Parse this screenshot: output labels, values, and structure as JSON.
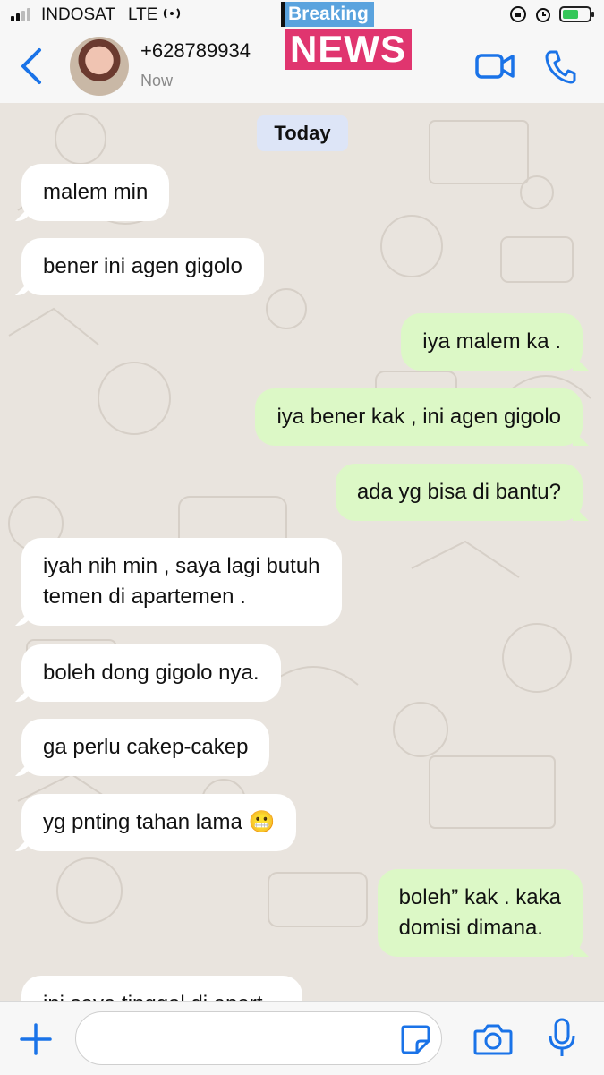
{
  "status_bar": {
    "carrier": "INDOSAT",
    "network": "LTE",
    "breaking_label": "Breaking",
    "news_label": "NEWS",
    "battery_level": 0.6
  },
  "header": {
    "contact_name": "+628789934",
    "contact_status": "Now"
  },
  "chat": {
    "day_label": "Today",
    "messages": [
      {
        "dir": "in",
        "text": "malem min"
      },
      {
        "dir": "in",
        "text": "bener ini agen gigolo"
      },
      {
        "dir": "out",
        "text": "iya malem ka ."
      },
      {
        "dir": "out",
        "text": "iya bener kak , ini agen gigolo"
      },
      {
        "dir": "out",
        "text": "ada yg bisa di bantu?"
      },
      {
        "dir": "in",
        "lines": [
          "iyah nih min , saya lagi butuh",
          "temen di apartemen ."
        ]
      },
      {
        "dir": "in",
        "text": "boleh dong gigolo nya."
      },
      {
        "dir": "in",
        "text": "ga perlu cakep-cakep"
      },
      {
        "dir": "in",
        "text": "yg pnting tahan lama 😬"
      },
      {
        "dir": "out",
        "lines": [
          "boleh” kak . kaka",
          "domisi dimana."
        ]
      },
      {
        "dir": "in",
        "text": "ini saya tinggal di apart..."
      }
    ]
  },
  "colors": {
    "accent": "#1a73e8",
    "incoming_bubble": "#ffffff",
    "outgoing_bubble": "#dcf8c6",
    "chat_background": "#e9e4de",
    "breaking_bg": "#5aa3de",
    "news_bg": "#e0356f"
  },
  "icons": {
    "back": "chevron-left-icon",
    "video": "video-camera-icon",
    "call": "phone-icon",
    "plus": "plus-icon",
    "sticker": "sticker-icon",
    "camera": "camera-icon",
    "mic": "microphone-icon"
  }
}
